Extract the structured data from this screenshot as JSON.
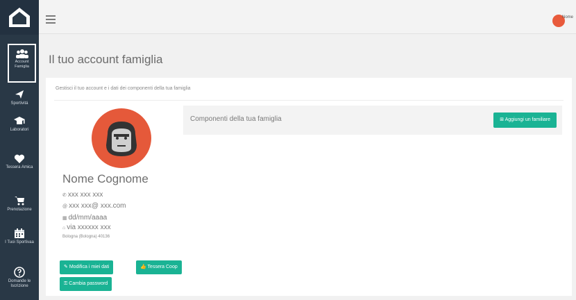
{
  "sidebar": {
    "items": [
      {
        "label": "Account Famiglia",
        "icon": "users-icon"
      },
      {
        "label": "Sportivitá",
        "icon": "plane-icon"
      },
      {
        "label": "Laboratori",
        "icon": "graduation-cap-icon"
      },
      {
        "label": "Tessera Amica",
        "icon": "heart-icon"
      },
      {
        "label": "Prenotazione",
        "icon": "shopping-cart-icon"
      },
      {
        "label": "I Tuoi Sportivaa",
        "icon": "calendar-icon"
      },
      {
        "label": "Domande le Iscrizione",
        "icon": "question-icon"
      }
    ]
  },
  "topbar": {
    "user_name": "Nome"
  },
  "page": {
    "title": "Il tuo account famiglia"
  },
  "card": {
    "subtitle": "Gestisci il tuo account e i dati dei componenti della tua famiglia"
  },
  "profile": {
    "name": "Nome Cognome",
    "phone": "xxx xxx xxx",
    "email": "xxx xxx@ xxx.com",
    "birthdate": "dd/mm/aaaa",
    "address": "via xxxxxx xxx",
    "city": "Bologna (Bologna) 40136"
  },
  "buttons": {
    "edit": "Modifica i miei dati",
    "card": "Tessera Coop",
    "password": "Cambia password"
  },
  "components": {
    "title": "Componenti della tua famiglia",
    "add_label": "Aggiungi un familiare"
  },
  "colors": {
    "accent": "#1ab394",
    "sidebar": "#293846",
    "avatar": "#e5593a"
  }
}
